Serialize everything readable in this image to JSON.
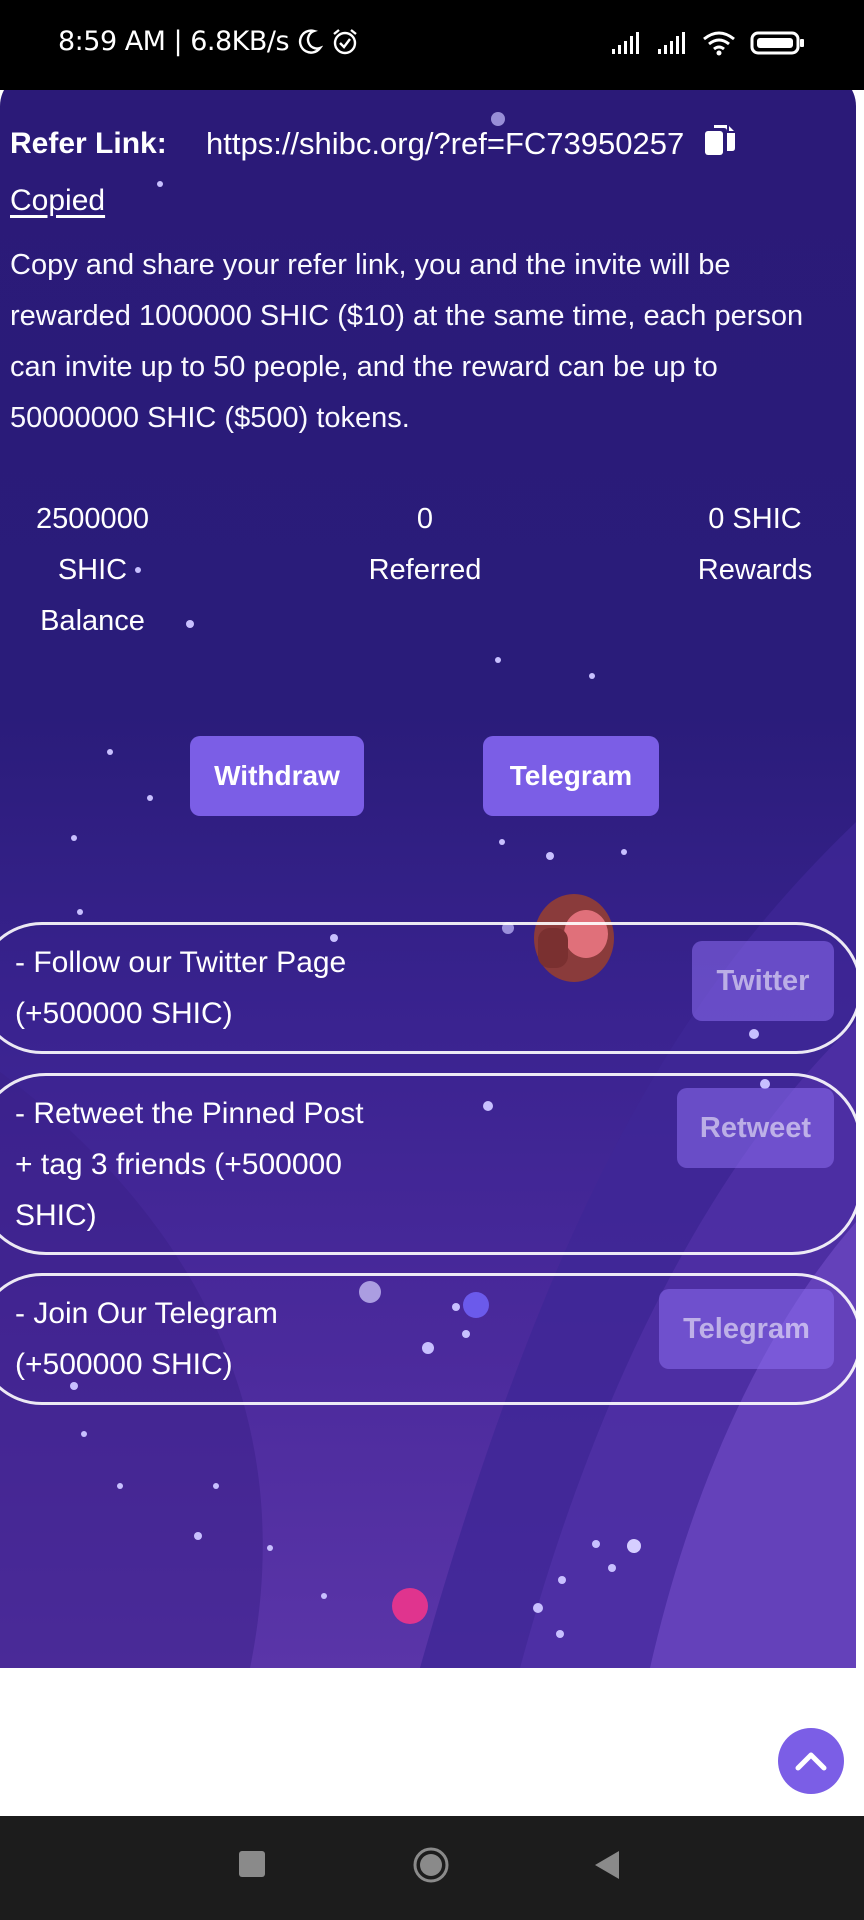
{
  "status_bar": {
    "time_speed": "8:59 AM | 6.8KB/s",
    "icons": [
      "moon-icon",
      "alarm-icon",
      "signal-icon",
      "signal-icon",
      "wifi-icon",
      "battery-icon"
    ]
  },
  "refer": {
    "label": "Refer Link:",
    "link": "https://shibc.org/?ref=FC73950257",
    "copied": "Copied",
    "description": "Copy and share your refer link, you and the invite will be rewarded 1000000 SHIC ($10) at the same time, each person can invite up to 50 people, and the reward can be up to 50000000 SHIC ($500) tokens."
  },
  "stats": {
    "balance_value": "2500000",
    "balance_unit": "SHIC",
    "balance_label": "Balance",
    "referred_value": "0",
    "referred_label": "Referred",
    "rewards_value": "0 SHIC",
    "rewards_label": "Rewards"
  },
  "actions": {
    "withdraw": "Withdraw",
    "telegram": "Telegram"
  },
  "tasks": [
    {
      "line1": "- Follow our Twitter Page",
      "line2": "(+500000 SHIC)",
      "line3": "",
      "button": "Twitter"
    },
    {
      "line1": "- Retweet the Pinned Post",
      "line2": "+ tag 3 friends (+500000",
      "line3": "SHIC)",
      "button": "Retweet"
    },
    {
      "line1": "- Join Our Telegram",
      "line2": "(+500000 SHIC)",
      "line3": "",
      "button": "Telegram"
    }
  ],
  "colors": {
    "panel": "#2b1a78",
    "button": "#7b5ee6",
    "nav_bar": "#1c1c1c"
  }
}
